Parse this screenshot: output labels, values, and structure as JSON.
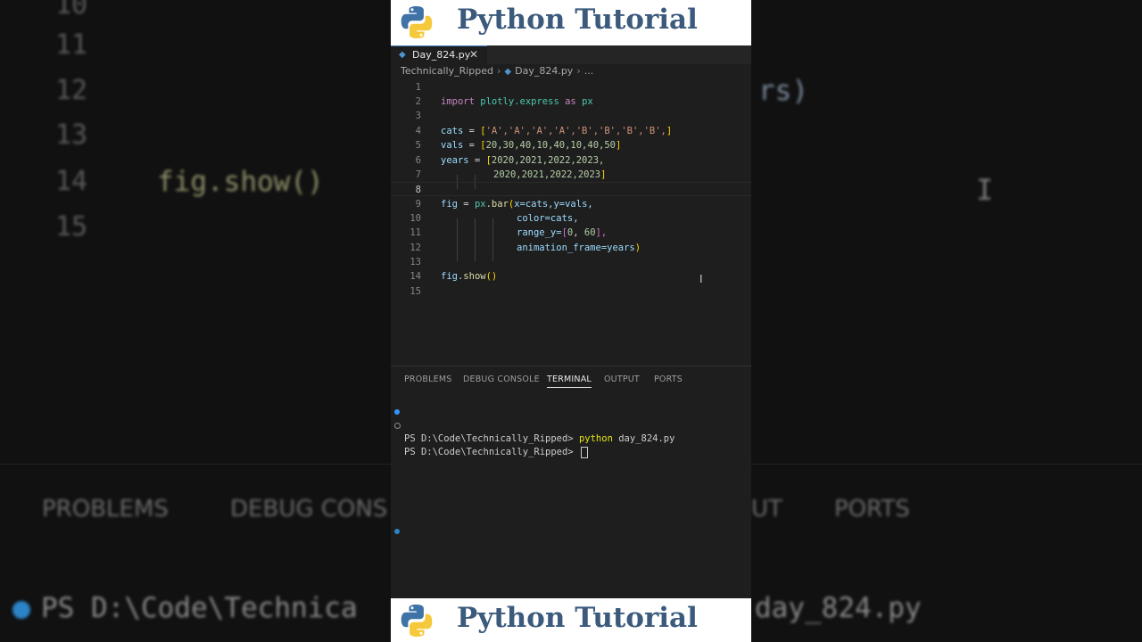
{
  "banner": {
    "title": "Python Tutorial",
    "logo_icon": "python-logo-icon",
    "colors": {
      "title": "#3b5a7c",
      "logo_blue": "#3f73a6",
      "logo_yellow": "#f6c93a"
    }
  },
  "editor_tab": {
    "filename": "Day_824.py",
    "close_glyph": "✕",
    "icon": "python-file-icon"
  },
  "breadcrumb": {
    "folder": "Technically_Ripped",
    "file": "Day_824.py",
    "ellipsis": "..."
  },
  "code_lines": [
    {
      "n": "1"
    },
    {
      "n": "2"
    },
    {
      "n": "3"
    },
    {
      "n": "4"
    },
    {
      "n": "5"
    },
    {
      "n": "6"
    },
    {
      "n": "7"
    },
    {
      "n": "8"
    },
    {
      "n": "9"
    },
    {
      "n": "10"
    },
    {
      "n": "11"
    },
    {
      "n": "12"
    },
    {
      "n": "13"
    },
    {
      "n": "14"
    },
    {
      "n": "15"
    }
  ],
  "code": {
    "l2": {
      "kw1": "import",
      "mod": "plotly.express",
      "kw2": "as",
      "alias": "px"
    },
    "l4": {
      "var": "cats",
      "op": " = ",
      "open": "[",
      "items": "'A','A','A','A','B','B','B','B',",
      "close": "]"
    },
    "l5": {
      "var": "vals",
      "op": " = ",
      "open": "[",
      "items": "20,30,40,10,40,10,40,50",
      "close": "]"
    },
    "l6": {
      "var": "years",
      "op": " = ",
      "open": "[",
      "items": "2020,2021,2022,2023,"
    },
    "l7": {
      "items": "2020,2021,2022,2023",
      "close": "]"
    },
    "l9": {
      "var": "fig",
      "op": " = ",
      "obj": "px",
      "dot": ".",
      "fn": "bar",
      "open": "(",
      "args": "x=cats,y=vals,"
    },
    "l10": {
      "args": "color=cats,"
    },
    "l11": {
      "arg": "range_y=",
      "open": "[",
      "v1": "0",
      "comma": ", ",
      "v2": "60",
      "close": "],"
    },
    "l12": {
      "args": "animation_frame=years",
      "close": ")"
    },
    "l14": {
      "var": "fig",
      "dot": ".",
      "fn": "show",
      "parens": "()"
    }
  },
  "panel_tabs": [
    "PROBLEMS",
    "DEBUG CONSOLE",
    "TERMINAL",
    "OUTPUT",
    "PORTS"
  ],
  "active_panel_tab": "TERMINAL",
  "terminal": {
    "line1_prompt": "PS D:\\Code\\Technically_Ripped> ",
    "line1_cmd": "python",
    "line1_args": " day_824.py",
    "line2_prompt": "PS D:\\Code\\Technically_Ripped> "
  },
  "background": {
    "line_numbers": [
      "10",
      "11",
      "12",
      "13",
      "14",
      "15"
    ],
    "code": "fig.show()",
    "right_fragment": "rs)",
    "tabs": [
      "PROBLEMS",
      "DEBUG CONS",
      "UT",
      "PORTS"
    ],
    "term_left": "PS D:\\Code\\Technica",
    "term_right": "day_824.py"
  },
  "colors": {
    "editor_bg": "#1e1e1e",
    "accent": "#3794ff"
  }
}
